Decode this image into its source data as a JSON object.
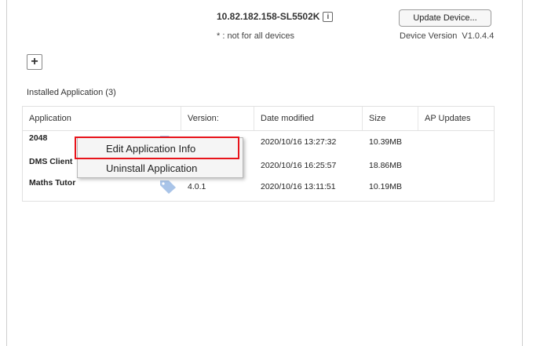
{
  "header": {
    "device_name": "10.82.182.158-SL5502K",
    "info_icon": "i",
    "note": "* : not for all devices",
    "update_button": "Update Device...",
    "device_version_label": "Device Version",
    "device_version_value": "V1.0.4.4"
  },
  "toolbar": {
    "add_button": "+"
  },
  "installed": {
    "label": "Installed Application (3)",
    "columns": [
      "Application",
      "Version:",
      "Date modified",
      "Size",
      "AP Updates"
    ],
    "rows": [
      {
        "application": "2048",
        "version": "",
        "date": "2020/10/16 13:27:32",
        "size": "10.39MB",
        "ap_updates": ""
      },
      {
        "application": "DMS Client",
        "version": "",
        "date": "2020/10/16 16:25:57",
        "size": "18.86MB",
        "ap_updates": ""
      },
      {
        "application": "Maths Tutor",
        "version": "4.0.1",
        "date": "2020/10/16 13:11:51",
        "size": "10.19MB",
        "ap_updates": ""
      }
    ]
  },
  "context_menu": {
    "items": [
      "Edit Application Info",
      "Uninstall Application"
    ]
  },
  "icons": {
    "tag": "tag-icon",
    "add": "plus-icon",
    "info": "info-icon"
  },
  "colors": {
    "highlight": "#e8141b",
    "tag": "#a9c4e8"
  }
}
